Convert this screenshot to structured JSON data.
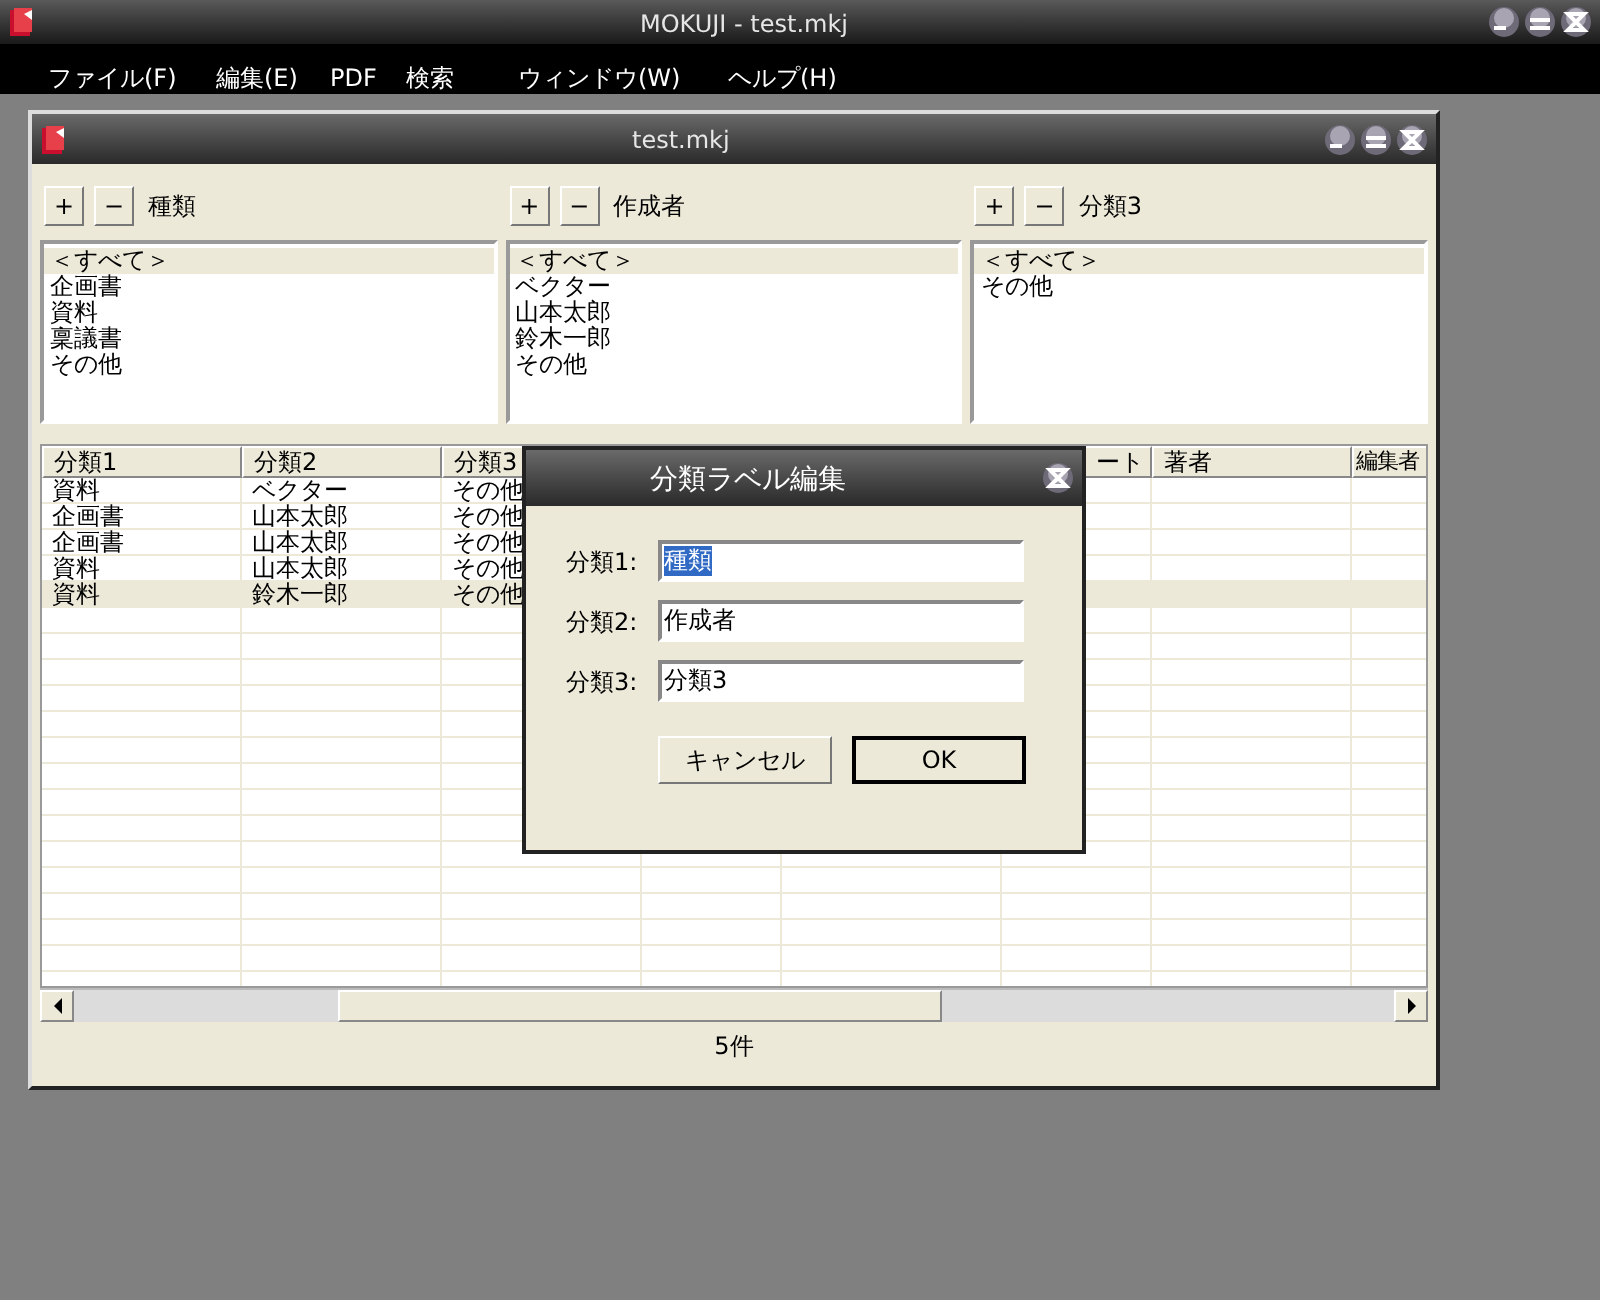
{
  "app_window": {
    "title": "MOKUJI - test.mkj"
  },
  "menu": [
    {
      "label": "ファイル(F)"
    },
    {
      "label": "編集(E)"
    },
    {
      "label": "PDF"
    },
    {
      "label": "検索"
    },
    {
      "label": "ウィンドウ(W)"
    },
    {
      "label": "ヘルプ(H)"
    }
  ],
  "document_window": {
    "title": "test.mkj"
  },
  "filters": [
    {
      "add": "+",
      "remove": "−",
      "label": "種類",
      "items": [
        {
          "label": "＜すべて＞",
          "selected": true
        },
        {
          "label": "企画書",
          "selected": false
        },
        {
          "label": "資料",
          "selected": false
        },
        {
          "label": "稟議書",
          "selected": false
        },
        {
          "label": "その他",
          "selected": false
        }
      ]
    },
    {
      "add": "+",
      "remove": "−",
      "label": "作成者",
      "items": [
        {
          "label": "＜すべて＞",
          "selected": true
        },
        {
          "label": "ベクター",
          "selected": false
        },
        {
          "label": "山本太郎",
          "selected": false
        },
        {
          "label": "鈴木一郎",
          "selected": false
        },
        {
          "label": "その他",
          "selected": false
        }
      ]
    },
    {
      "add": "+",
      "remove": "−",
      "label": "分類3",
      "items": [
        {
          "label": "＜すべて＞",
          "selected": true
        },
        {
          "label": "その他",
          "selected": false
        }
      ]
    }
  ],
  "table": {
    "columns": [
      {
        "label": "分類1"
      },
      {
        "label": "分類2"
      },
      {
        "label": "分類3"
      },
      {},
      {},
      {
        "label": "ート"
      },
      {
        "label": "著者"
      },
      {
        "label": "編集者"
      }
    ],
    "rows": [
      {
        "cells": [
          "資料",
          "ベクター",
          "その他"
        ],
        "selected": false
      },
      {
        "cells": [
          "企画書",
          "山本太郎",
          "その他"
        ],
        "selected": false
      },
      {
        "cells": [
          "企画書",
          "山本太郎",
          "その他"
        ],
        "selected": false
      },
      {
        "cells": [
          "資料",
          "山本太郎",
          "その他"
        ],
        "selected": false
      },
      {
        "cells": [
          "資料",
          "鈴木一郎",
          "その他"
        ],
        "selected": true
      }
    ]
  },
  "status_bar": "5件",
  "dialog": {
    "title": "分類ラベル編集",
    "fields": [
      {
        "label": "分類1:",
        "value": "種類",
        "text_selected": true
      },
      {
        "label": "分類2:",
        "value": "作成者",
        "text_selected": false
      },
      {
        "label": "分類3:",
        "value": "分類3",
        "text_selected": false
      }
    ],
    "buttons": [
      {
        "label": "キャンセル",
        "default": false
      },
      {
        "label": "OK",
        "default": true
      }
    ]
  }
}
